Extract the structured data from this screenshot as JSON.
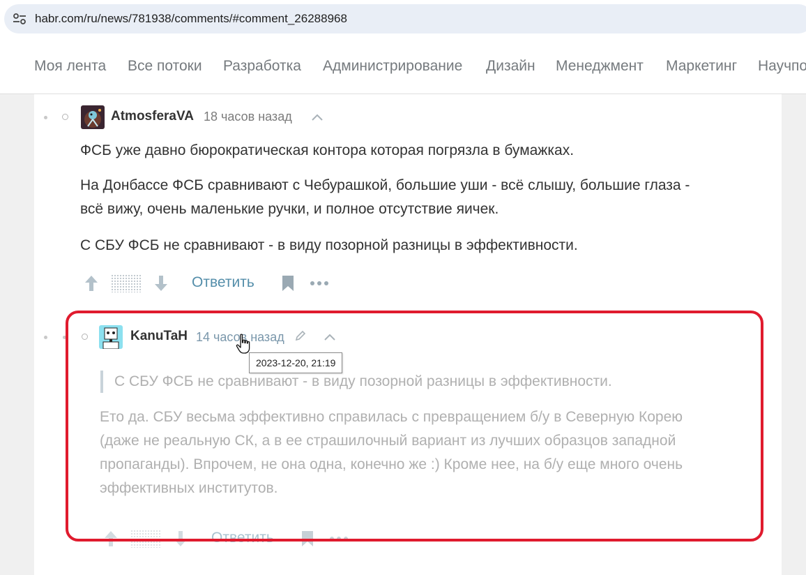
{
  "browser": {
    "url": "habr.com/ru/news/781938/comments/#comment_26288968"
  },
  "nav": {
    "items": [
      "Моя лента",
      "Все потоки",
      "Разработка",
      "Администрирование",
      "Дизайн",
      "Менеджмент",
      "Маркетинг",
      "Научпоп"
    ]
  },
  "comments": [
    {
      "author": "AtmosferaVA",
      "time": "18 часов назад",
      "paragraphs": [
        "ФСБ уже давно бюрократическая контора которая погрязла в бумажках.",
        "На Донбассе ФСБ сравнивают с Чебурашкой, большие уши - всё слышу, большие глаза -",
        "всё вижу, очень маленькие ручки, и полное отсутствие яичек.",
        "С СБУ ФСБ не сравнивают - в виду позорной разницы в эффективности."
      ],
      "reply_label": "Ответить"
    },
    {
      "author": "KanuTaH",
      "time": "14 часов назад",
      "quote": "С СБУ ФСБ не сравнивают - в виду позорной разницы в эффективности.",
      "paragraphs": [
        "Ето да. СБУ весьма эффективно справилась с превращением б/у в Северную Корею",
        "(даже не реальную СК, а в ее страшилочный вариант из лучших образцов западной",
        "пропаганды). Впрочем, не она одна, конечно же :) Кроме нее, на б/у еще много очень",
        "эффективных институтов."
      ],
      "reply_label": "Ответить"
    }
  ],
  "tooltip": {
    "text": "2023-12-20, 21:19"
  },
  "colors": {
    "accent_link": "#548eaa",
    "highlight_border": "#e01b2e",
    "text": "#333333",
    "muted": "#7b7b7b"
  }
}
